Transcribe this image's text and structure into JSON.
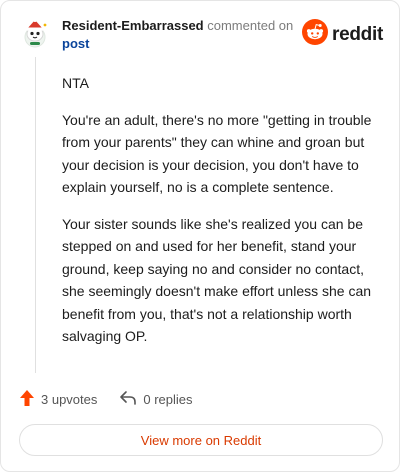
{
  "comment": {
    "username": "Resident-Embarrassed",
    "action_text": "commented on",
    "post_link_text": "post",
    "paragraphs": [
      "NTA",
      "You're an adult, there's no more \"getting in trouble from your parents\" they can whine and groan but your decision is your decision, you don't have to explain yourself, no is a complete sentence.",
      "Your sister sounds like she's realized you can be stepped on and used for her benefit, stand your ground, keep saying no and consider no contact, she seemingly doesn't make effort unless she can benefit from you, that's not a relationship worth salvaging OP."
    ]
  },
  "brand": {
    "wordmark": "reddit",
    "color": "#ff4500"
  },
  "actions": {
    "upvotes_label": "3 upvotes",
    "replies_label": "0 replies"
  },
  "footer": {
    "view_more_label": "View more on Reddit"
  },
  "icons": [
    "avatar",
    "reddit-logo-icon",
    "upvote-arrow-icon",
    "reply-icon"
  ]
}
